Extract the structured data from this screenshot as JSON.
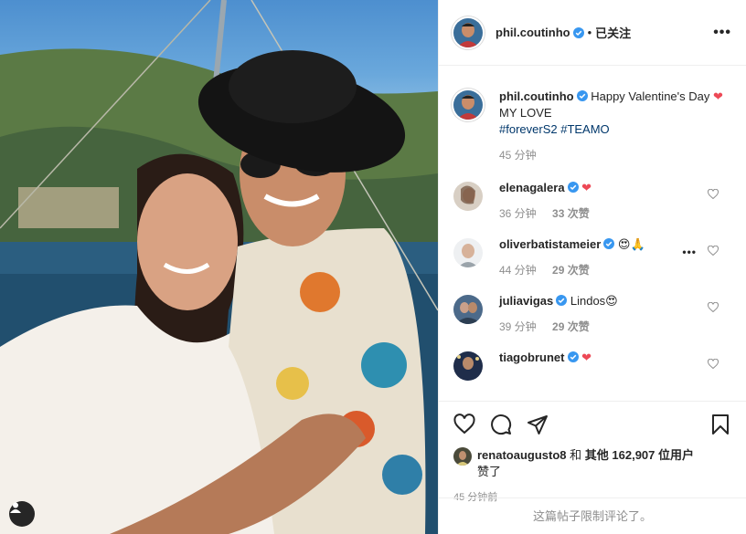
{
  "post": {
    "author": "phil.coutinho",
    "follow_state": "已关注",
    "separator": "•",
    "more_label": "•••"
  },
  "caption": {
    "author": "phil.coutinho",
    "text_start": "Happy Valentine's Day",
    "heart": "❤",
    "text_end": "MY LOVE",
    "hashtag1": "#foreverS2",
    "hashtag2": "#TEAMO",
    "time": "45 分钟"
  },
  "comments": [
    {
      "user": "elenagalera",
      "text": "❤",
      "time": "36 分钟",
      "likes": "33 次赞"
    },
    {
      "user": "oliverbatistameier",
      "text": "😍🙏",
      "time": "44 分钟",
      "likes": "29 次赞"
    },
    {
      "user": "juliavigas",
      "text": "Lindos😍",
      "time": "39 分钟",
      "likes": "29 次赞"
    },
    {
      "user": "tiagobrunet",
      "text": "❤",
      "time": "",
      "likes": ""
    }
  ],
  "likes": {
    "liker": "renatoaugusto8",
    "conj": "和",
    "others": "其他 162,907 位用户",
    "verb": "赞了"
  },
  "post_time": "45 分钟前",
  "comments_disabled": "这篇帖子限制评论了。",
  "icons": {
    "verified": "verified-badge-icon",
    "like": "heart-outline-icon",
    "comment": "comment-bubble-icon",
    "share": "paper-plane-icon",
    "save": "bookmark-icon",
    "more": "more-dots-icon"
  },
  "colors": {
    "verified": "#3897f0",
    "heart": "#ed4956",
    "hashtag": "#00376b",
    "meta": "#8e8e8e"
  }
}
